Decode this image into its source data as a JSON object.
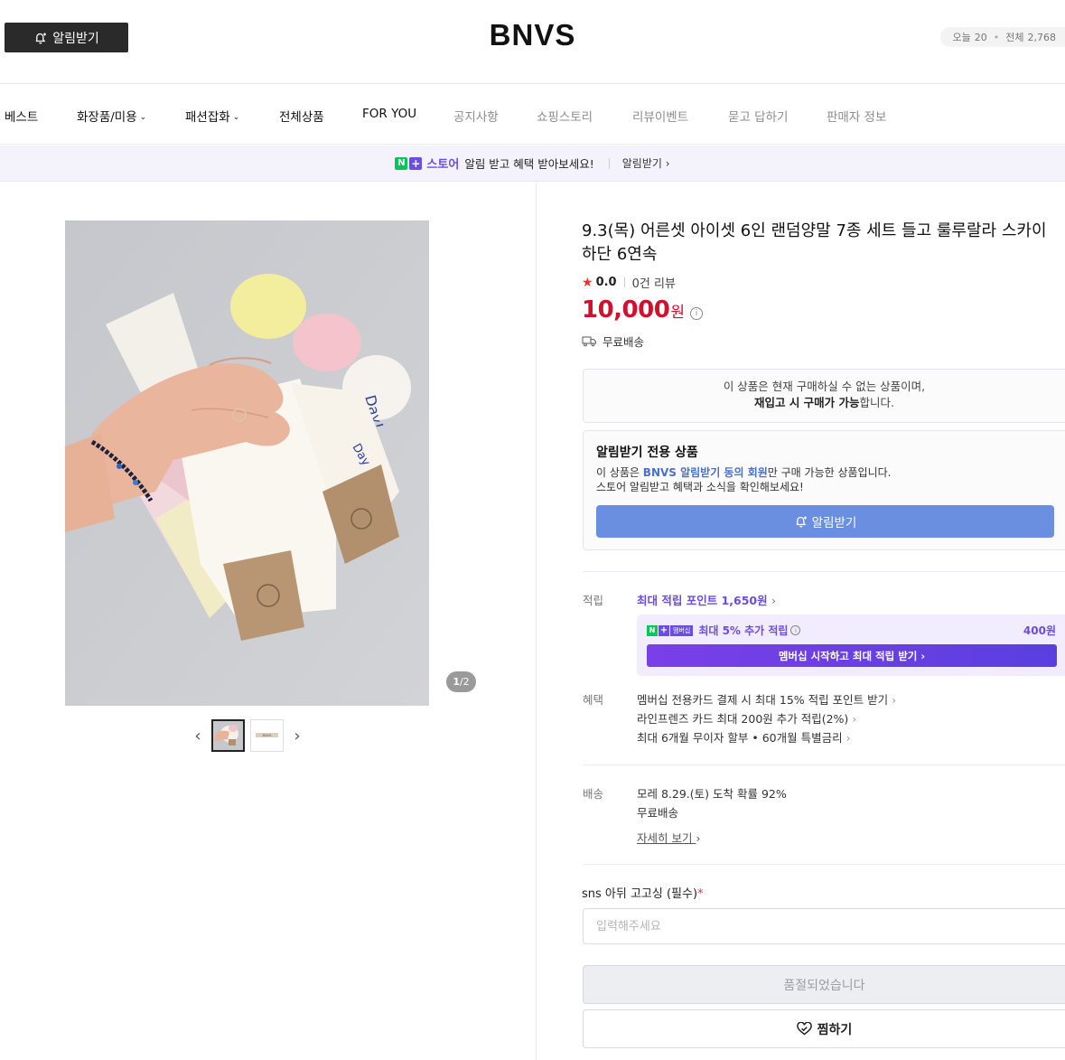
{
  "header": {
    "notify_button": "알림받기",
    "brand": "BNVS",
    "visits_today_label": "오늘",
    "visits_today": "20",
    "visits_total_label": "전체",
    "visits_total": "2,768"
  },
  "nav": {
    "items": [
      {
        "label": "베스트"
      },
      {
        "label": "화장품/미용"
      },
      {
        "label": "패션잡화"
      },
      {
        "label": "전체상품"
      },
      {
        "label": "FOR YOU"
      },
      {
        "label": "공지사항"
      },
      {
        "label": "쇼핑스토리"
      },
      {
        "label": "리뷰이벤트"
      },
      {
        "label": "묻고 답하기"
      },
      {
        "label": "판매자 정보"
      }
    ]
  },
  "promo": {
    "logo_n": "N",
    "logo_plus": "+",
    "logo_store": "스토어",
    "text": "알림 받고 혜택 받아보세요!",
    "link": "알림받기"
  },
  "gallery": {
    "counter_current": "1",
    "counter_total": "/2",
    "thumb_label": "BNVS"
  },
  "product": {
    "title": "9.3(목) 어른셋 아이셋 6인 랜덤양말 7종 세트 들고 룰루랄라 스카이하단 6연속",
    "rating": "0.0",
    "review_count": "0건 리뷰",
    "price": "10,000",
    "currency": "원",
    "shipping": "무료배송"
  },
  "unavailable": {
    "line1": "이 상품은 현재 구매하실 수 없는 상품이며,",
    "line2_bold": "재입고 시 구매가 가능",
    "line2_rest": "합니다."
  },
  "exclusive": {
    "title": "알림받기 전용 상품",
    "desc1_pre": "이 상품은 ",
    "desc1_hl": "BNVS 알림받기 동의 회원",
    "desc1_post": "만 구매 가능한 상품입니다.",
    "desc2": "스토어 알림받고 혜택과 소식을 확인해보세요!",
    "button": "알림받기"
  },
  "points": {
    "label": "적립",
    "link": "최대 적립 포인트 1,650원",
    "badge_n": "N",
    "badge_plus": "+",
    "badge_text": "멤버십",
    "member_text": "최대 5% 추가 적립",
    "member_amount": "400원",
    "member_button": "멤버십 시작하고 최대 적립 받기"
  },
  "benefits": {
    "label": "혜택",
    "items": [
      "멤버십 전용카드 결제 시 최대 15% 적립 포인트 받기",
      "라인프렌즈 카드 최대 200원 추가 적립(2%)",
      "최대 6개월 무이자 할부 • 60개월 특별금리"
    ]
  },
  "delivery": {
    "label": "배송",
    "line1": "모레 8.29.(토) 도착 확률 92%",
    "line2": "무료배송",
    "detail_link": "자세히 보기"
  },
  "option": {
    "label": "sns 아뒤 고고싱 (필수)",
    "required_mark": "*",
    "placeholder": "입력해주세요",
    "value": ""
  },
  "actions": {
    "soldout": "품절되었습니다",
    "wishlist": "찜하기"
  },
  "colors": {
    "price_red": "#d0112b",
    "naver_green": "#03c75a",
    "membership_purple": "#6b4ce6",
    "notify_blue": "#6a8fe0"
  }
}
